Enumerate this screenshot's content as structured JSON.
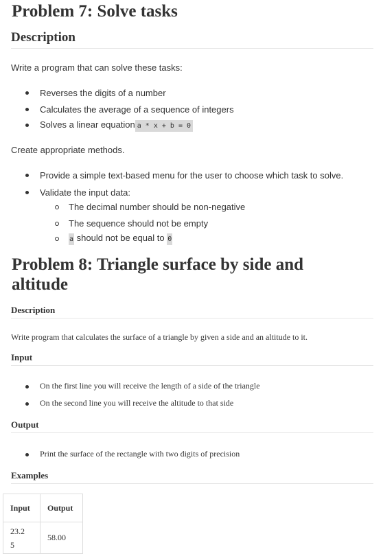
{
  "problem7": {
    "title": "Problem 7: Solve tasks",
    "description_heading": "Description",
    "intro": "Write a program that can solve these tasks:",
    "tasks": [
      "Reverses the digits of a number",
      "Calculates the average of a sequence of integers",
      "Solves a linear equation"
    ],
    "equation_code": "a * x + b = 0",
    "methods_text": "Create appropriate methods.",
    "requirements": [
      "Provide a simple text-based menu for the user to choose which task to solve.",
      "Validate the input data:"
    ],
    "validations": [
      "The decimal number should be non-negative",
      "The sequence should not be empty"
    ],
    "validation_last": {
      "code_a": "a",
      "text": " should not be equal to ",
      "code_zero": "0"
    }
  },
  "problem8": {
    "title_line1": "Problem 8: Triangle surface by side and",
    "title_line2": "altitude",
    "description_heading": "Description",
    "description": "Write program that calculates the surface of a triangle by given a side and an altitude to it.",
    "input_heading": "Input",
    "inputs": [
      "On the first line you will receive the length of a side of the triangle",
      "On the second line you will receive the altitude to that side"
    ],
    "output_heading": "Output",
    "outputs": [
      "Print the surface of the rectangle with two digits of precision"
    ],
    "examples_heading": "Examples",
    "examples_table": {
      "headers": [
        "Input",
        "Output"
      ],
      "rows": [
        {
          "input_line1": "23.2",
          "input_line2": "5",
          "output": "58.00"
        }
      ]
    }
  }
}
